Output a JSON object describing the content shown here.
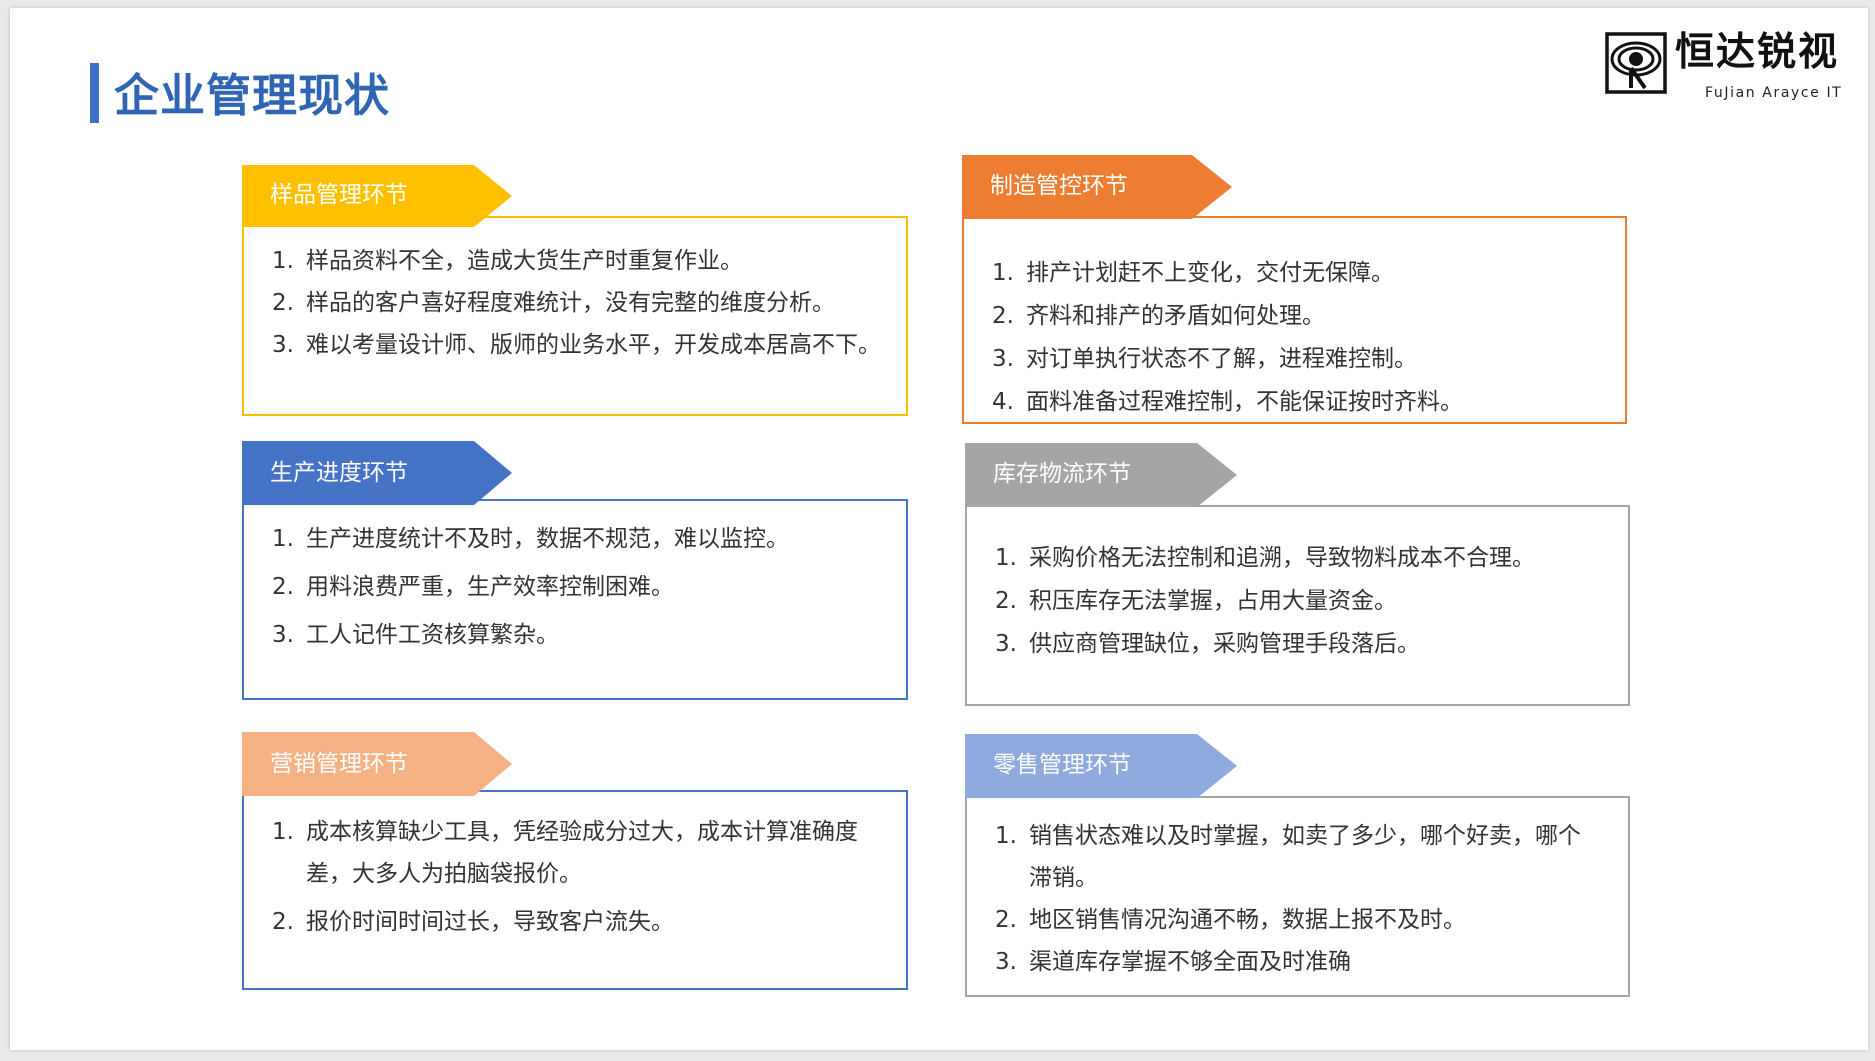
{
  "title": "企业管理现状",
  "logo": {
    "name": "恒达锐视",
    "subtitle": "FuJian Arayce IT"
  },
  "colors": {
    "title": "#2f65b3",
    "sample": "#ffc000",
    "manufacturing": "#ed7d31",
    "production": "#4472c4",
    "inventory": "#a5a5a5",
    "marketing": "#f4b183",
    "retail": "#8faadc"
  },
  "sections": [
    {
      "name": "样品管理环节",
      "items": [
        {
          "num": "1.",
          "text": "样品资料不全，造成大货生产时重复作业。"
        },
        {
          "num": "2.",
          "text": "样品的客户喜好程度难统计，没有完整的维度分析。"
        },
        {
          "num": "3.",
          "text": "难以考量设计师、版师的业务水平，开发成本居高不下。"
        }
      ]
    },
    {
      "name": "制造管控环节",
      "items": [
        {
          "num": "1.",
          "text": "排产计划赶不上变化，交付无保障。"
        },
        {
          "num": "2.",
          "text": "齐料和排产的矛盾如何处理。"
        },
        {
          "num": "3.",
          "text": " 对订单执行状态不了解，进程难控制。"
        },
        {
          "num": "4.",
          "text": "面料准备过程难控制，不能保证按时齐料。"
        }
      ]
    },
    {
      "name": "生产进度环节",
      "items": [
        {
          "num": "1.",
          "text": "生产进度统计不及时，数据不规范，难以监控。"
        },
        {
          "num": "2.",
          "text": "用料浪费严重，生产效率控制困难。"
        },
        {
          "num": "3.",
          "text": "工人记件工资核算繁杂。"
        }
      ]
    },
    {
      "name": "库存物流环节",
      "items": [
        {
          "num": "1.",
          "text": "采购价格无法控制和追溯，导致物料成本不合理。"
        },
        {
          "num": "2.",
          "text": "积压库存无法掌握，占用大量资金。"
        },
        {
          "num": "3.",
          "text": "供应商管理缺位，采购管理手段落后。"
        }
      ]
    },
    {
      "name": "营销管理环节",
      "items": [
        {
          "num": "1.",
          "text": "成本核算缺少工具，凭经验成分过大，成本计算准确度差，大多人为拍脑袋报价。"
        },
        {
          "num": "2.",
          "text": "报价时间时间过长，导致客户流失。"
        }
      ]
    },
    {
      "name": "零售管理环节",
      "items": [
        {
          "num": "1.",
          "text": "销售状态难以及时掌握，如卖了多少，哪个好卖，哪个滞销。"
        },
        {
          "num": "2.",
          "text": "地区销售情况沟通不畅，数据上报不及时。"
        },
        {
          "num": "3.",
          "text": "渠道库存掌握不够全面及时准确"
        }
      ]
    }
  ]
}
